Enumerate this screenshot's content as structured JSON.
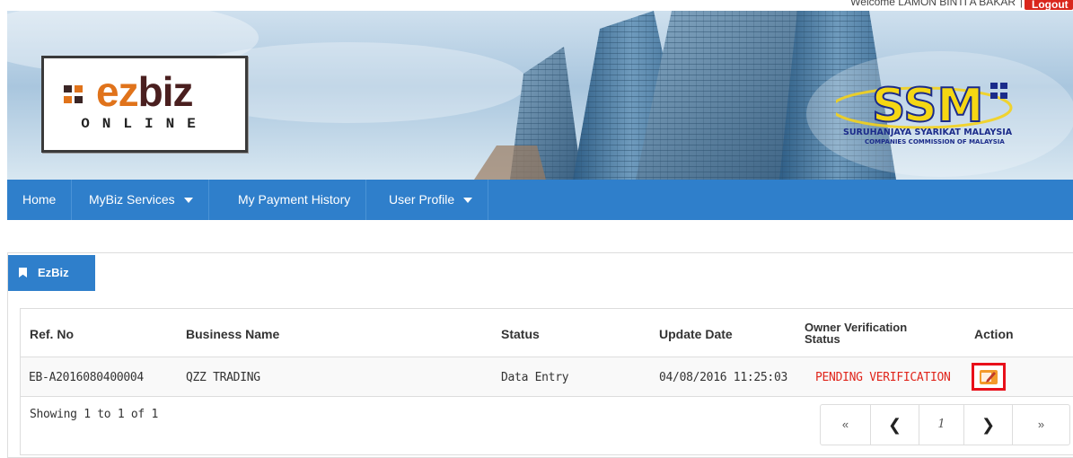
{
  "header": {
    "welcome_text": "Welcome LAMON BINTI A BAKAR",
    "separator": "|",
    "logout_label": "Logout"
  },
  "banner": {
    "logo_ez": "ez",
    "logo_biz": "biz",
    "logo_online": "ONLINE",
    "ssm_logo": "SSM",
    "ssm_tagline_1": "SURUHANJAYA SYARIKAT MALAYSIA",
    "ssm_tagline_2": "COMPANIES COMMISSION OF MALAYSIA"
  },
  "nav": {
    "home": "Home",
    "mybiz": "MyBiz Services",
    "payment": "My Payment History",
    "profile": "User Profile"
  },
  "panel": {
    "tab_label": "EzBiz"
  },
  "table": {
    "columns": {
      "ref": "Ref. No",
      "business": "Business Name",
      "status": "Status",
      "update": "Update Date",
      "owner_1": "Owner Verification",
      "owner_2": "Status",
      "action": "Action"
    },
    "rows": [
      {
        "ref": "EB-A2016080400004",
        "business": "QZZ TRADING",
        "status": "Data Entry",
        "update": "04/08/2016 11:25:03",
        "owner_status": "PENDING VERIFICATION",
        "action_icon": "edit-icon"
      }
    ],
    "showing": "Showing 1 to 1 of 1"
  },
  "pagination": {
    "first": "«",
    "prev": "❮",
    "page": "1",
    "next": "❯",
    "last": "»"
  },
  "colors": {
    "nav_blue": "#2f7fcb",
    "logout_red": "#d9261c",
    "pending_red": "#e0261c",
    "highlight_red": "#e8101a"
  }
}
